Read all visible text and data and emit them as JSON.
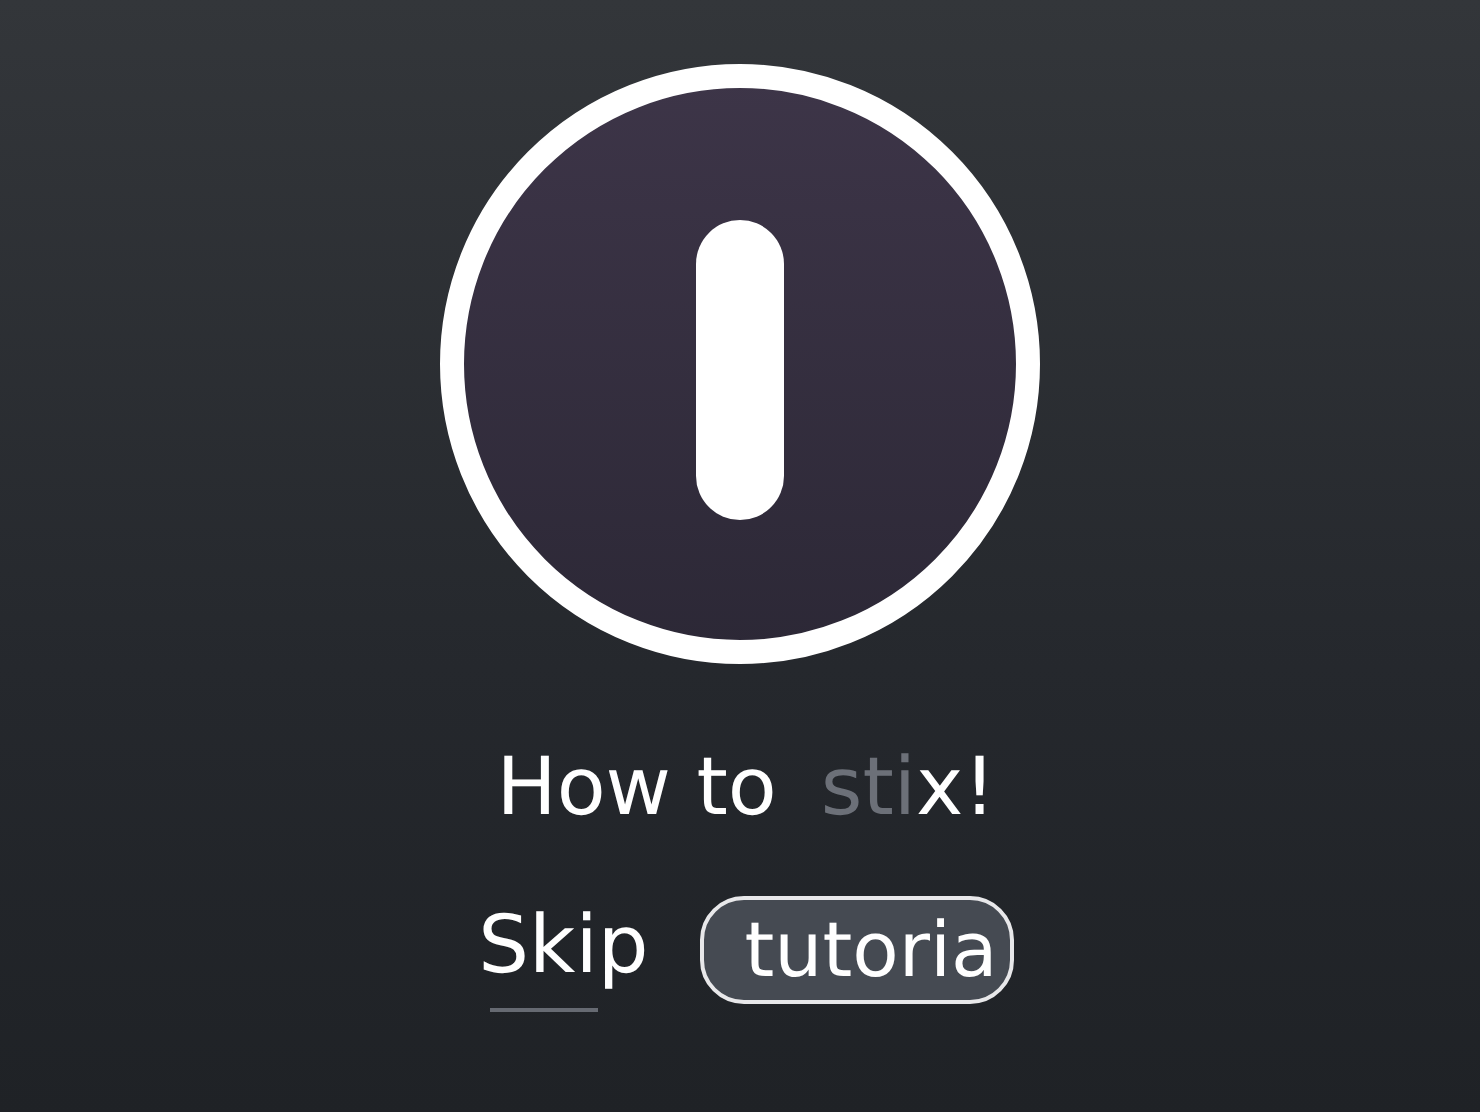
{
  "title": {
    "parts": [
      {
        "text": "How to",
        "muted": false
      },
      {
        "text": "sti",
        "muted": true
      },
      {
        "text": "x!",
        "muted": false
      }
    ]
  },
  "skip_link": {
    "label": "Skip"
  },
  "tutorial_button": {
    "label": "tutoria"
  }
}
